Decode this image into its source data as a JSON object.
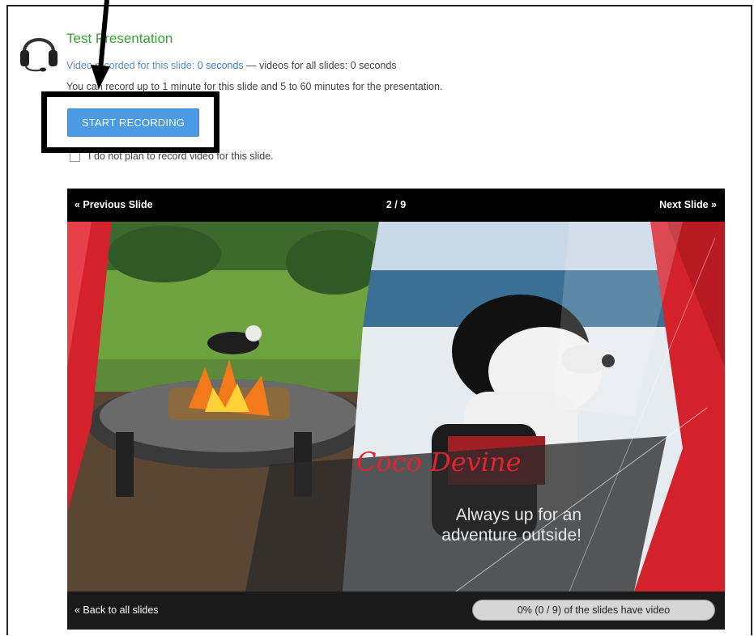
{
  "header": {
    "title": "Test Presentation",
    "recorded_prefix": "Video recorded for this slide:",
    "recorded_value": "0 seconds",
    "all_slides_text": "— videos for all slides: 0 seconds",
    "limits_text": "You can record up to 1 minute for this slide and 5 to 60 minutes for the presentation."
  },
  "actions": {
    "start_recording_label": "START RECORDING",
    "no_plan_label": "I do not plan to record video for this slide."
  },
  "viewer": {
    "prev_label": "« Previous Slide",
    "counter": "2 / 9",
    "next_label": "Next Slide »",
    "back_label": "« Back to all slides",
    "progress_text": "0% (0 / 9) of the slides have video",
    "progress_fraction": 0
  },
  "slide": {
    "title": "Coco Devine",
    "subtitle_line1": "Always up for an",
    "subtitle_line2": "adventure outside!"
  },
  "colors": {
    "title_green": "#3aa132",
    "button_blue": "#4a9be3",
    "slide_accent_red": "#e3232e"
  }
}
